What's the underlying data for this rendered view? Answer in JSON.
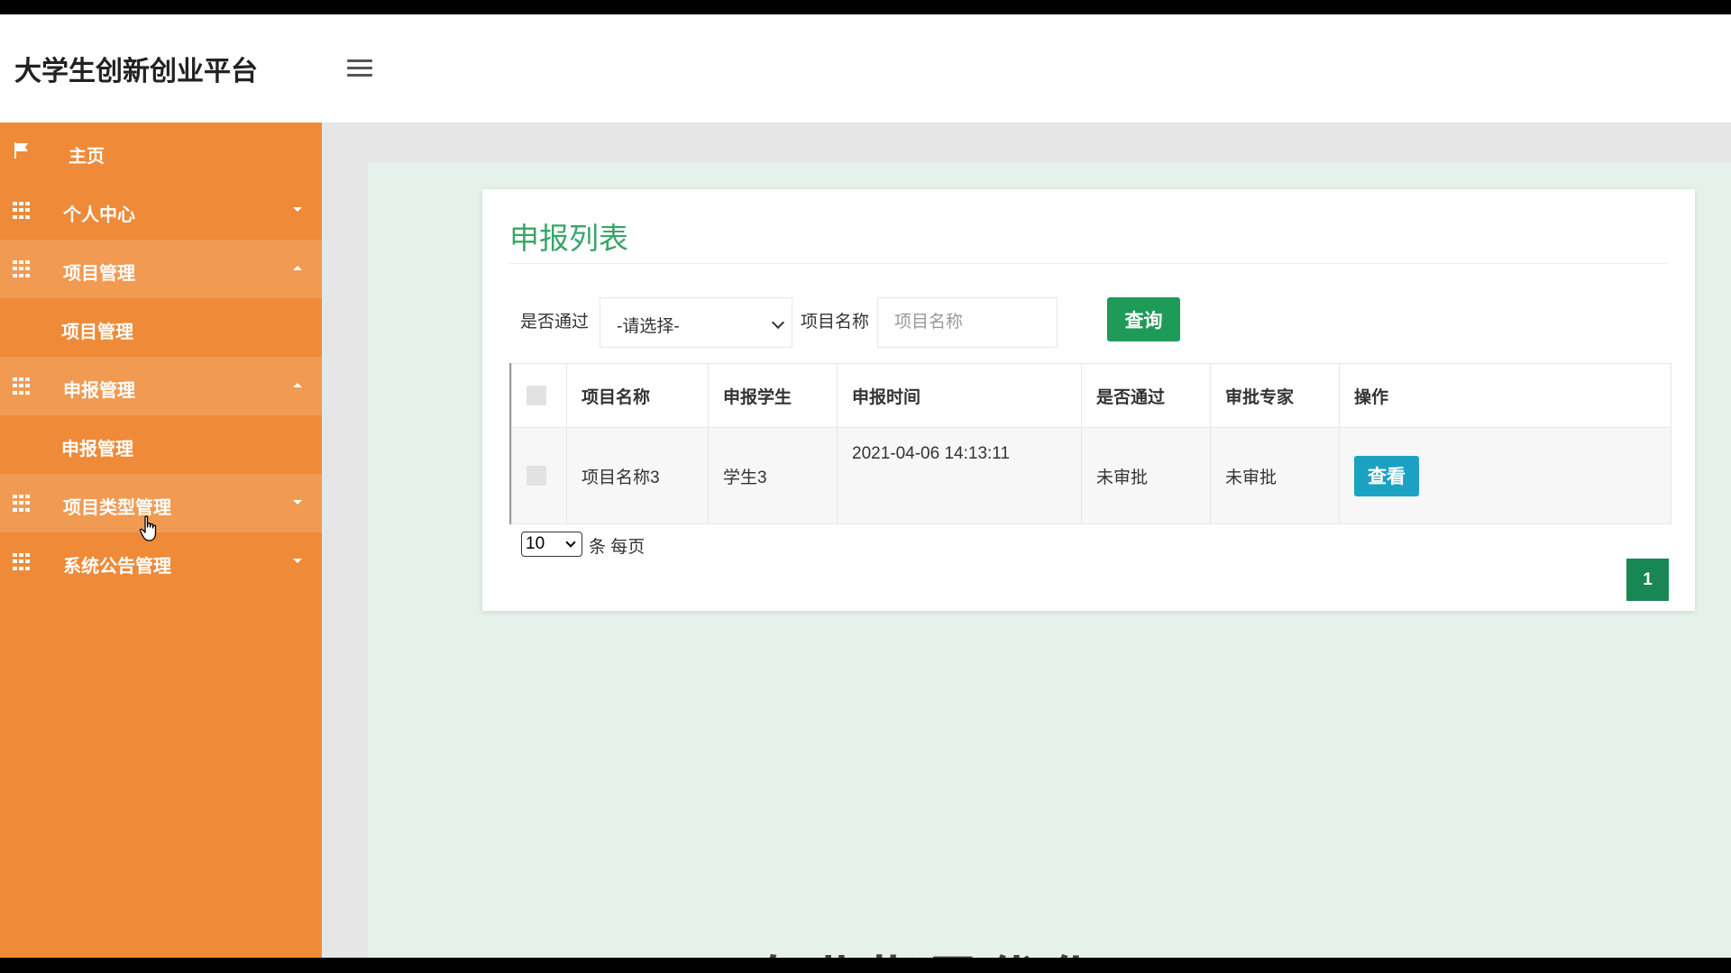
{
  "header": {
    "title": "大学生创新创业平台"
  },
  "sidebar": {
    "items": [
      {
        "label": "主页",
        "icon": "flag-icon",
        "open": false
      },
      {
        "label": "个人中心",
        "icon": "grid-icon",
        "open": false
      },
      {
        "label": "项目管理",
        "icon": "grid-icon",
        "open": true,
        "sub": "项目管理"
      },
      {
        "label": "申报管理",
        "icon": "grid-icon",
        "open": true,
        "sub": "申报管理"
      },
      {
        "label": "项目类型管理",
        "icon": "grid-icon",
        "open": false
      },
      {
        "label": "系统公告管理",
        "icon": "grid-icon",
        "open": false
      }
    ]
  },
  "panel": {
    "title": "申报列表",
    "filter": {
      "passed_label": "是否通过",
      "passed_select": "-请选择-",
      "name_label": "项目名称",
      "name_placeholder": "项目名称",
      "query_label": "查询"
    },
    "table": {
      "headers": [
        "项目名称",
        "申报学生",
        "申报时间",
        "是否通过",
        "审批专家",
        "操作"
      ],
      "rows": [
        {
          "name": "项目名称3",
          "student": "学生3",
          "time": "2021-04-06 14:13:11",
          "passed": "未审批",
          "expert": "未审批",
          "action": "查看"
        }
      ]
    },
    "pagination": {
      "page_size": "10",
      "per_page_label": "条 每页",
      "current_page": "1"
    }
  },
  "overlay": {
    "watermark": "专业指导优化"
  },
  "colors": {
    "sidebar": "#ee8a38",
    "accent": "#3aa56a",
    "query_button": "#1e9b58",
    "view_button": "#1ba2c3"
  }
}
